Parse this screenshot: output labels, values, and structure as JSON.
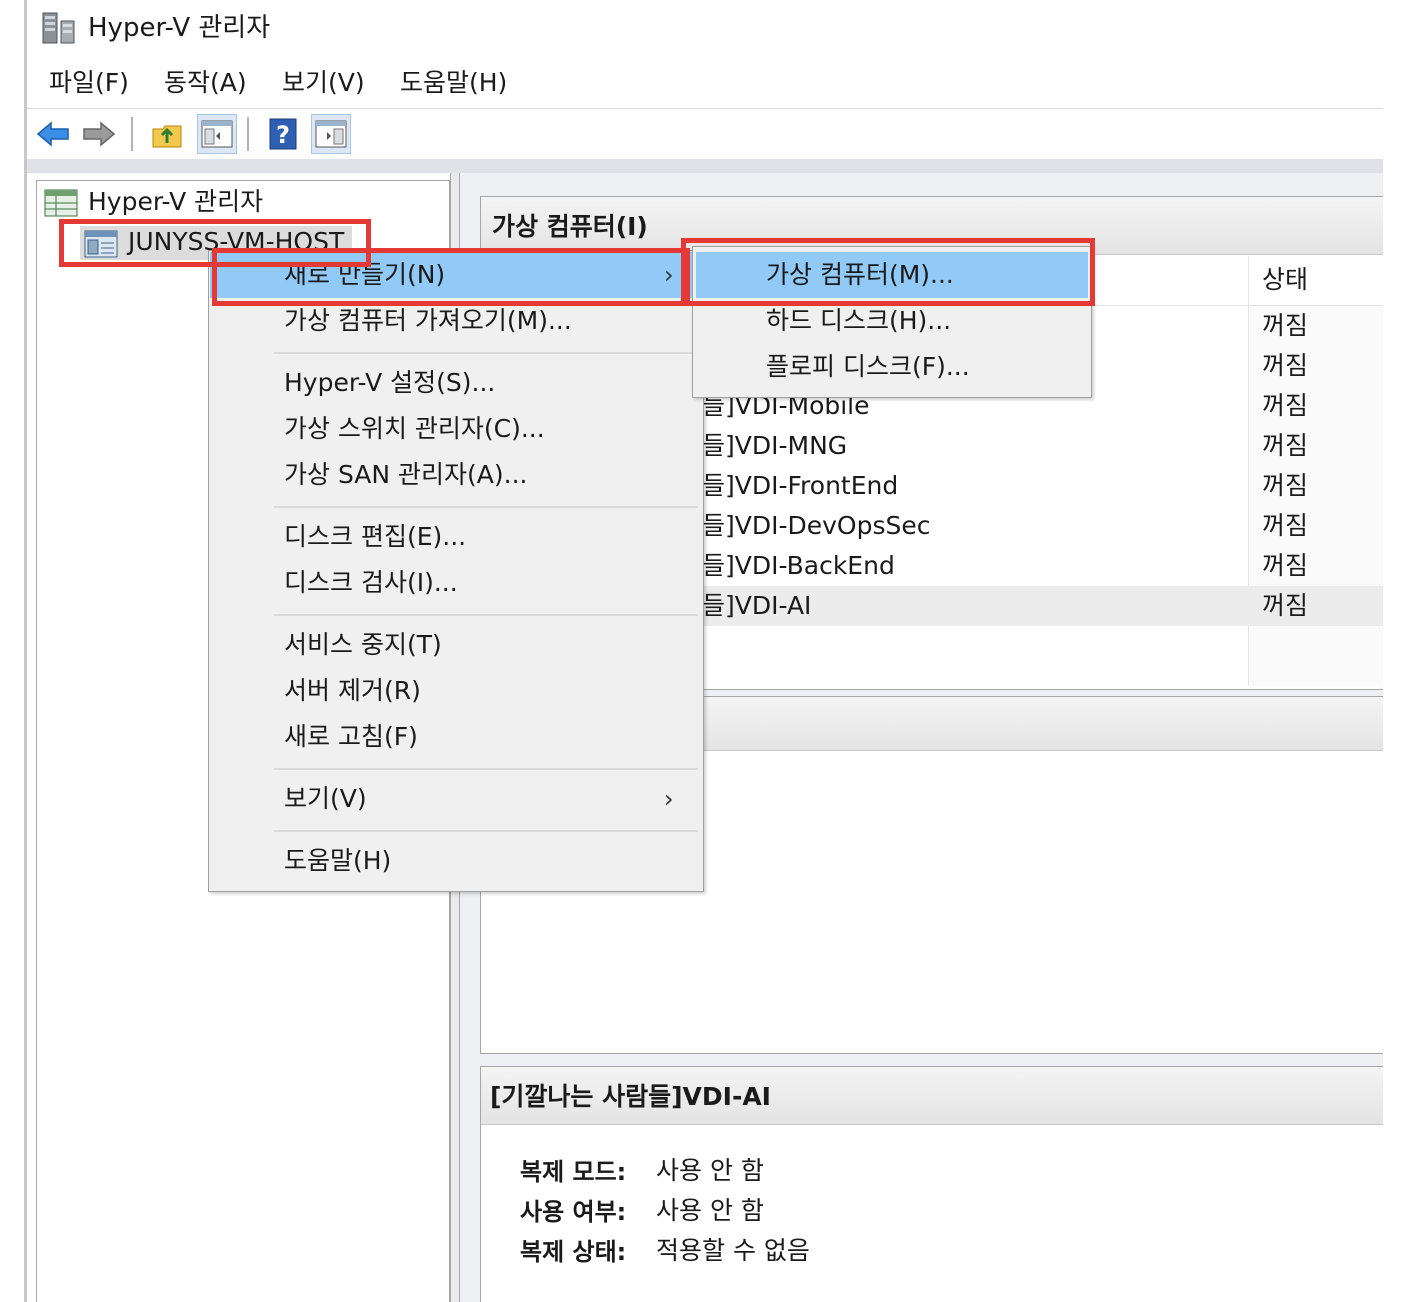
{
  "window": {
    "title": "Hyper-V 관리자"
  },
  "menubar": [
    {
      "label": "파일(F)"
    },
    {
      "label": "동작(A)"
    },
    {
      "label": "보기(V)"
    },
    {
      "label": "도움말(H)"
    }
  ],
  "toolbar": {
    "buttons": [
      {
        "icon": "back-arrow-icon"
      },
      {
        "icon": "forward-arrow-icon"
      },
      {
        "icon": "up-folder-icon"
      },
      {
        "icon": "show-hide-console-tree-icon"
      },
      {
        "icon": "help-icon"
      },
      {
        "icon": "show-hide-action-pane-icon"
      }
    ]
  },
  "tree": {
    "root": {
      "label": "Hyper-V 관리자",
      "icon": "hyperv-manager-icon"
    },
    "host": {
      "label": "JUNYSS-VM-HOST",
      "icon": "server-icon"
    }
  },
  "vm_panel": {
    "title": "가상 컴퓨터(I)",
    "columns": {
      "status": "상태"
    },
    "rows": [
      {
        "name": "",
        "status": "꺼짐"
      },
      {
        "name": "",
        "status": "꺼짐"
      },
      {
        "name": "들]VDI-Mobile",
        "status": "꺼짐"
      },
      {
        "name": "들]VDI-MNG",
        "status": "꺼짐"
      },
      {
        "name": "들]VDI-FrontEnd",
        "status": "꺼짐"
      },
      {
        "name": "들]VDI-DevOpsSec",
        "status": "꺼짐"
      },
      {
        "name": "들]VDI-BackEnd",
        "status": "꺼짐"
      },
      {
        "name": "들]VDI-AI",
        "status": "꺼짐"
      }
    ]
  },
  "context_menu": {
    "items": [
      {
        "label": "새로 만들기(N)",
        "submenu": true
      },
      {
        "label": "가상 컴퓨터 가져오기(M)..."
      },
      {
        "label": "Hyper-V 설정(S)..."
      },
      {
        "label": "가상 스위치 관리자(C)..."
      },
      {
        "label": "가상 SAN 관리자(A)..."
      },
      {
        "label": "디스크 편집(E)..."
      },
      {
        "label": "디스크 검사(I)..."
      },
      {
        "label": "서비스 중지(T)"
      },
      {
        "label": "서버 제거(R)"
      },
      {
        "label": "새로 고침(F)"
      },
      {
        "label": "보기(V)",
        "submenu": true
      },
      {
        "label": "도움말(H)"
      }
    ],
    "arrow": "›"
  },
  "submenu": {
    "items": [
      {
        "label": "가상 컴퓨터(M)..."
      },
      {
        "label": "하드 디스크(H)..."
      },
      {
        "label": "플로피 디스크(F)..."
      }
    ]
  },
  "details": {
    "title": "[기깔나는 사람들]VDI-AI",
    "fields": [
      {
        "label": "복제 모드:",
        "value": "사용 안 함"
      },
      {
        "label": "사용 여부:",
        "value": "사용 안 함"
      },
      {
        "label": "복제 상태:",
        "value": "적용할 수 없음"
      }
    ]
  },
  "colors": {
    "highlight": "#91c9f7",
    "annotation_red": "#e53935",
    "menu_bg": "#f0f0f0"
  }
}
